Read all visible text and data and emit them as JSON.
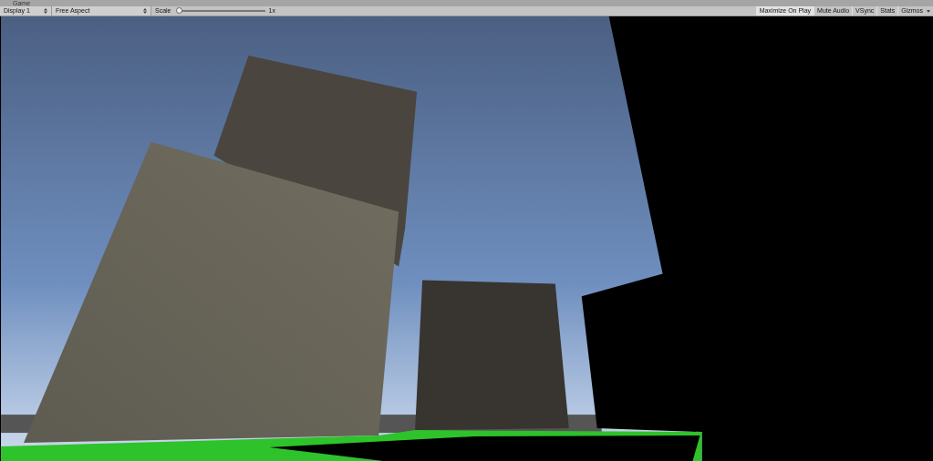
{
  "window": {
    "tab_title": "Game"
  },
  "toolbar": {
    "display": "Display 1",
    "aspect": "Free Aspect",
    "scale_label": "Scale",
    "scale": {
      "level": 0,
      "reading": "1x"
    },
    "toggles": [
      {
        "label": "Maximize On Play",
        "selected": true
      },
      {
        "label": "Mute Audio",
        "selected": false
      },
      {
        "label": "VSync",
        "selected": false
      },
      {
        "label": "Stats",
        "selected": false
      }
    ],
    "gizmos": "Gizmos"
  }
}
